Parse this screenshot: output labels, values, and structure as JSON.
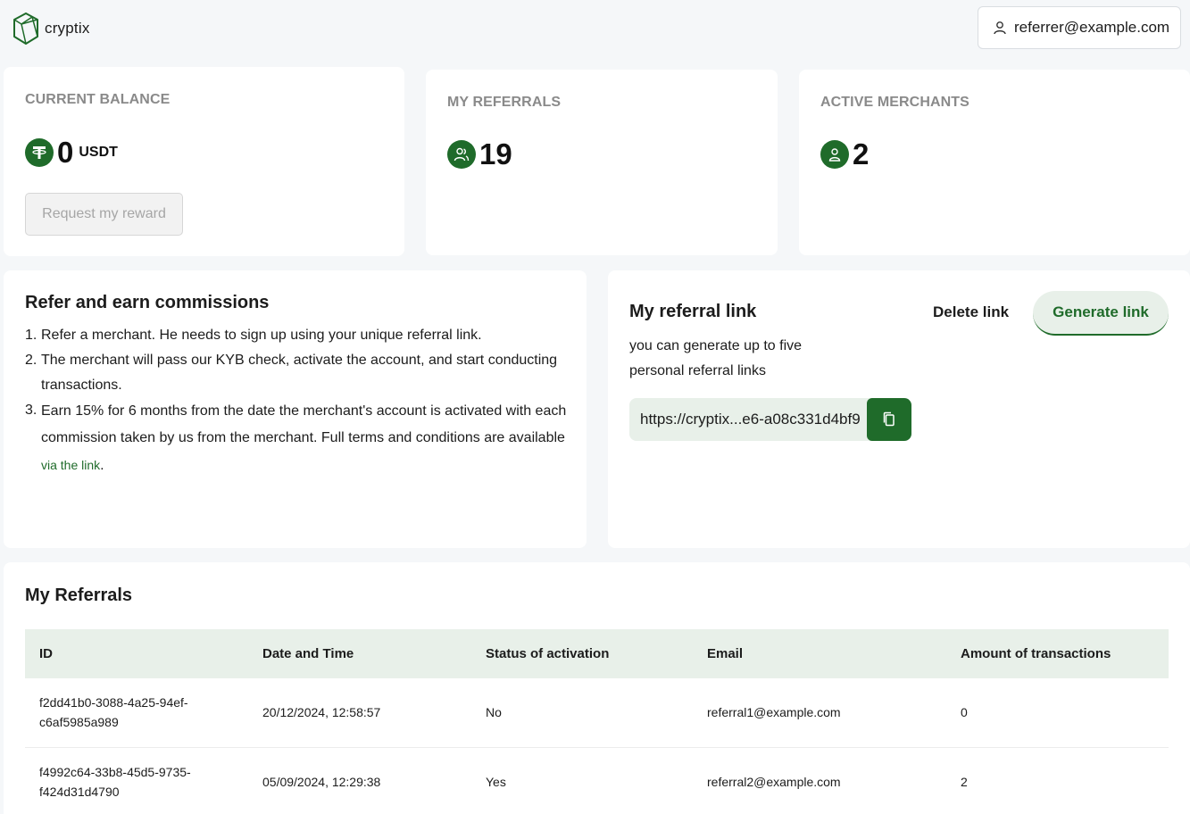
{
  "brand": {
    "name": "cryptix",
    "accent": "#1f6b2a"
  },
  "header": {
    "user_email": "referrer@example.com",
    "user_icon": "user-icon"
  },
  "balance": {
    "label": "CURRENT BALANCE",
    "value": "0",
    "unit": "USDT",
    "icon": "tether-icon",
    "button_label": "Request my reward"
  },
  "referrals_stat": {
    "label": "MY REFERRALS",
    "value": "19",
    "icon": "users-icon"
  },
  "merchants_stat": {
    "label": "ACTIVE MERCHANTS",
    "value": "2",
    "icon": "user-icon"
  },
  "refer": {
    "title": "Refer and earn commissions",
    "steps": [
      {
        "num": "1.",
        "text": "Refer a merchant. He needs to sign up using your unique referral link."
      },
      {
        "num": "2.",
        "text": "The merchant will pass our KYB check, activate the account, and start conducting transactions."
      },
      {
        "num": "3.",
        "text": "Earn 15% for 6 months from the date the merchant's account is activated with each commission taken by us from the merchant. Full terms and conditions are available ",
        "link": "via the link",
        "after": "."
      }
    ]
  },
  "referral_link": {
    "title": "My referral link",
    "subtitle_line1": "you can generate up to five",
    "subtitle_line2": "personal referral links",
    "delete_label": "Delete link",
    "generate_label": "Generate link",
    "url": "https://cryptix...e6-a08c331d4bf9",
    "copy_icon": "copy-icon"
  },
  "table": {
    "title": "My Referrals",
    "columns": [
      "ID",
      "Date and Time",
      "Status of activation",
      "Email",
      "Amount of transactions"
    ],
    "rows": [
      {
        "id_line1": "f2dd41b0-3088-4a25-94ef-",
        "id_line2": "c6af5985a989",
        "date": "20/12/2024, 12:58:57",
        "status": "No",
        "email": "referral1@example.com",
        "amount": "0"
      },
      {
        "id_line1": "f4992c64-33b8-45d5-9735-",
        "id_line2": "f424d31d4790",
        "date": "05/09/2024, 12:29:38",
        "status": "Yes",
        "email": "referral2@example.com",
        "amount": "2"
      }
    ]
  }
}
